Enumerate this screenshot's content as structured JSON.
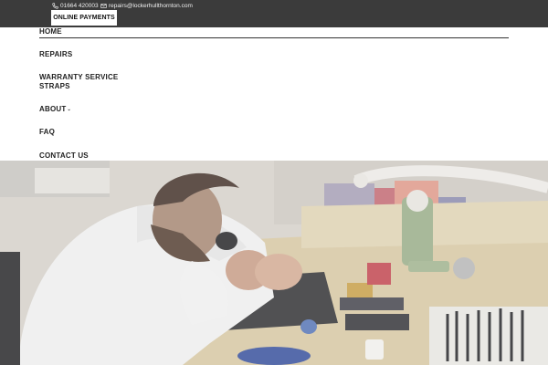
{
  "topbar": {
    "phone": "01664 420003",
    "email": "repairs@lockerhullthornton.com",
    "button_label": "ONLINE PAYMENTS"
  },
  "nav": {
    "items": [
      {
        "label": "HOME",
        "active": true
      },
      {
        "label": "REPAIRS"
      },
      {
        "label": "WARRANTY SERVICE"
      },
      {
        "label": "STRAPS"
      },
      {
        "label": "ABOUT",
        "has_dropdown": true
      },
      {
        "label": "FAQ"
      },
      {
        "label": "CONTACT US"
      }
    ]
  },
  "icons": {
    "phone": "phone-icon",
    "email": "envelope-icon",
    "dropdown": "chevron-down-icon"
  },
  "colors": {
    "topbar_bg": "#3b3b3b",
    "button_bg": "#ffffff",
    "nav_text": "#1f1f1f"
  }
}
